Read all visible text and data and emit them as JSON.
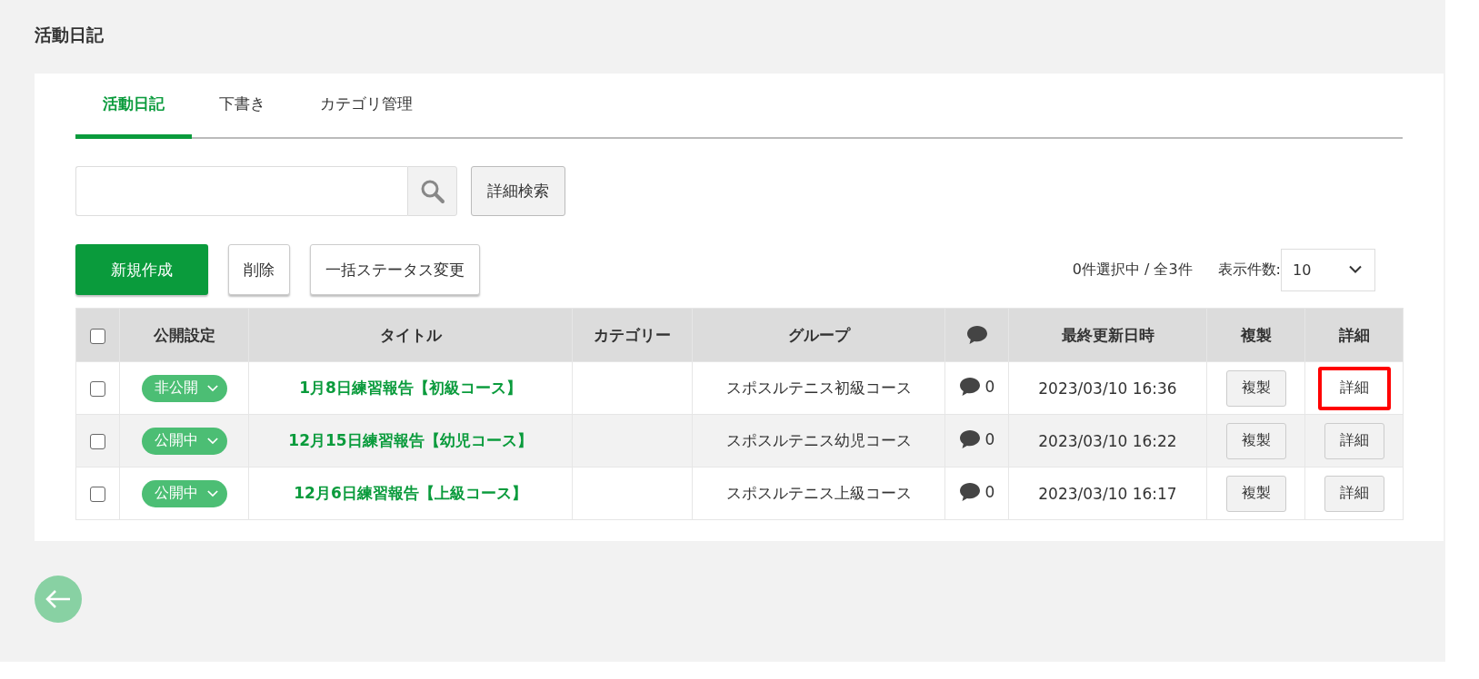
{
  "page_title": "活動日記",
  "tabs": [
    {
      "label": "活動日記",
      "selected": true
    },
    {
      "label": "下書き",
      "selected": false
    },
    {
      "label": "カテゴリ管理",
      "selected": false
    }
  ],
  "search": {
    "advanced_button": "詳細検索"
  },
  "toolbar": {
    "buttons": [
      {
        "label": "新規作成",
        "kind": "primary"
      },
      {
        "label": "削除",
        "kind": "default"
      },
      {
        "label": "一括ステータス変更",
        "kind": "default"
      }
    ],
    "selection_count": "0件選択中 / 全3件",
    "page_size_label": "表示件数:",
    "page_size": "10"
  },
  "table": {
    "all_checked": false,
    "columns": [
      {
        "kind": "check"
      },
      {
        "kind": "text",
        "label": "公開設定"
      },
      {
        "kind": "text",
        "label": "タイトル"
      },
      {
        "kind": "text",
        "label": "カテゴリー"
      },
      {
        "kind": "text",
        "label": "グループ"
      },
      {
        "kind": "comment"
      },
      {
        "kind": "text",
        "label": "最終更新日時"
      },
      {
        "kind": "text",
        "label": "複製"
      },
      {
        "kind": "text",
        "label": "詳細"
      }
    ],
    "rows": [
      {
        "checked": false,
        "status": "非公開",
        "title": "1月8日練習報告【初級コース】",
        "group": "スポスルテニス初級コース",
        "comments": "0",
        "updated": "2023/03/10 16:36",
        "copy_button": "複製",
        "detail_button": "詳細",
        "detail_highlighted": true
      },
      {
        "checked": false,
        "status": "公開中",
        "title": "12月15日練習報告【幼児コース】",
        "group": "スポスルテニス幼児コース",
        "comments": "0",
        "updated": "2023/03/10 16:22",
        "copy_button": "複製",
        "detail_button": "詳細",
        "detail_highlighted": false
      },
      {
        "checked": false,
        "status": "公開中",
        "title": "12月6日練習報告【上級コース】",
        "group": "スポスルテニス上級コース",
        "comments": "0",
        "updated": "2023/03/10 16:17",
        "copy_button": "複製",
        "detail_button": "詳細",
        "detail_highlighted": false
      }
    ]
  }
}
